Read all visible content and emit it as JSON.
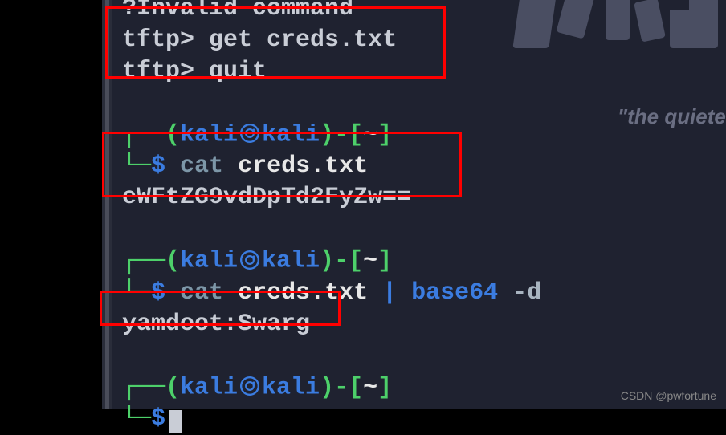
{
  "terminal": {
    "top_fragment": "?Invalid command",
    "tftp1_prompt": "tftp> ",
    "tftp1_cmd": "get creds.txt",
    "tftp2_prompt": "tftp> ",
    "tftp2_cmd": "quit",
    "ps1_user": "kali",
    "ps1_host": "kali",
    "ps1_cwd": "~",
    "ps1_dollar": "$",
    "block1_cmd": "cat",
    "block1_arg": "creds.txt",
    "block1_output": "eWFtZG9vdDpTd2FyZw==",
    "block2_cmd": "cat",
    "block2_arg": "creds.txt",
    "block2_pipe": "|",
    "block2_cmd2": "base64",
    "block2_flag": "-d",
    "block2_output": "yamdoot:Swarg",
    "corner_top": "┌──",
    "corner_bottom": "└─",
    "paren_open": "(",
    "paren_close": ")",
    "dash": "-",
    "bracket_open": "[",
    "bracket_close": "]"
  },
  "background": {
    "tagline": "\"the quieter"
  },
  "watermark": "CSDN @pwfortune"
}
